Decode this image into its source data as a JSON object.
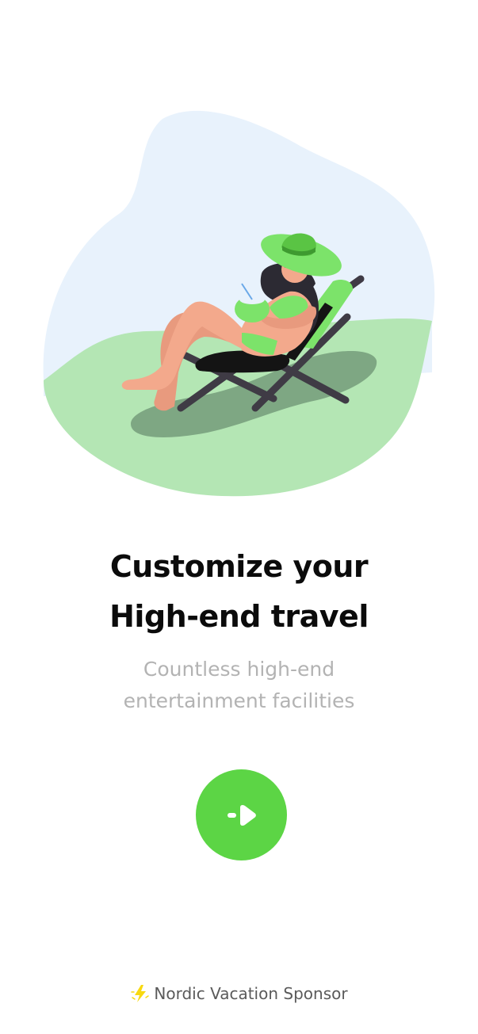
{
  "illustration": {
    "icon": "woman-on-deck-chair-illustration",
    "colors": {
      "sky_blob": "#e8f2fc",
      "grass": "#b4e6b4",
      "shadow": "#7ea783",
      "accent_green": "#7ce36a",
      "skin": "#f3a98c",
      "chair_frame": "#3f3b45"
    }
  },
  "title": {
    "line1": "Customize your",
    "line2": "High-end travel"
  },
  "subtitle": {
    "line1": "Countless high-end",
    "line2": "entertainment facilities"
  },
  "next_button": {
    "icon": "arrow-right-icon",
    "color": "#5cd545"
  },
  "footer": {
    "icon": "lightning-icon",
    "icon_color": "#f8d90f",
    "label": "Nordic Vacation Sponsor"
  }
}
